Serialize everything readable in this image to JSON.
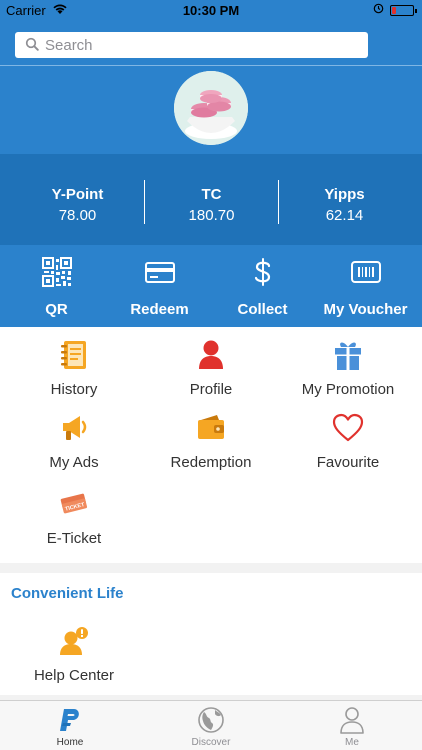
{
  "status_bar": {
    "carrier": "Carrier",
    "time": "10:30 PM"
  },
  "search": {
    "placeholder": "Search"
  },
  "stats": [
    {
      "label": "Y-Point",
      "value": "78.00"
    },
    {
      "label": "TC",
      "value": "180.70"
    },
    {
      "label": "Yipps",
      "value": "62.14"
    }
  ],
  "actions": [
    {
      "label": "QR",
      "icon": "qr-code-icon"
    },
    {
      "label": "Redeem",
      "icon": "card-icon"
    },
    {
      "label": "Collect",
      "icon": "dollar-icon"
    },
    {
      "label": "My Voucher",
      "icon": "voucher-icon"
    }
  ],
  "menu": [
    {
      "label": "History",
      "icon": "notebook-icon"
    },
    {
      "label": "Profile",
      "icon": "person-icon"
    },
    {
      "label": "My Promotion",
      "icon": "gift-icon"
    },
    {
      "label": "My Ads",
      "icon": "megaphone-icon"
    },
    {
      "label": "Redemption",
      "icon": "wallet-icon"
    },
    {
      "label": "Favourite",
      "icon": "heart-icon"
    },
    {
      "label": "E-Ticket",
      "icon": "ticket-icon",
      "badge_text": "TICKET"
    }
  ],
  "convenient_life": {
    "title": "Convenient Life",
    "items": [
      {
        "label": "Help Center",
        "icon": "help-center-icon",
        "badge": "!"
      }
    ]
  },
  "tab_bar": [
    {
      "label": "Home",
      "icon": "home-logo-icon",
      "active": true
    },
    {
      "label": "Discover",
      "icon": "globe-icon",
      "active": false
    },
    {
      "label": "Me",
      "icon": "person-outline-icon",
      "active": false
    }
  ],
  "colors": {
    "primary": "#2b82cc",
    "primary_dark": "#1f72b8",
    "accent_orange": "#f5a623",
    "accent_red": "#e0322d",
    "accent_blue": "#4a90d9"
  }
}
